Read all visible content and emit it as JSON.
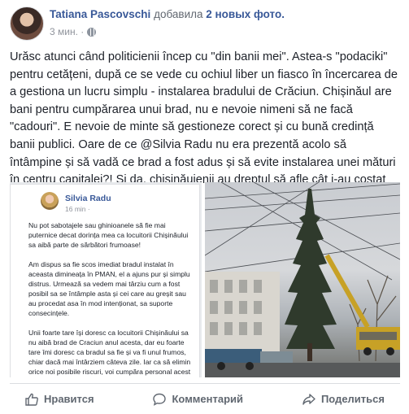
{
  "header": {
    "author": "Tatiana Pascovschi",
    "action": "добавила",
    "action_count": "2 новых фото.",
    "time": "3 мин. ·"
  },
  "post": {
    "text": "Urăsc atunci când politicienii încep cu \"din banii mei\". Astea-s \"podaciki\" pentru cetățeni, după ce se vede cu ochiul liber un fiasco în încercarea de a gestiona un lucru simplu - instalarea bradului de Crăciun. Chișinăul are bani pentru cumpărarea unui brad, nu e nevoie nimeni să ne facă \"cadouri\". E nevoie de minte să gestioneze corect și cu bună credință banii publici. Oare de ce @Silvia Radu nu era prezentă acolo să întâmpine și să vadă ce brad a fost adus și să evite instalarea unei mături în centru capitalei?! Și da, chișinăuienii au dreptul să afle cât i-au costat experimentele noii conduceri."
  },
  "photo1": {
    "name": "Silvia Radu",
    "meta": "16 min ·",
    "paragraphs": [
      "Nu pot sabotajele sau ghinioanele să fie mai puternice decat dorința mea ca locuitorii Chișinăului sa aibă parte de sărbători frumoase!",
      "Am dispus sa fie scos imediat bradul instalat în aceasta dimineața în PMAN, el a ajuns pur și simplu distrus. Urmează sa vedem mai târziu cum a fost posibil sa se întâmple asta și cei care au greșit sau au procedat asa în mod intenționat, sa suporte consecințele.",
      "Unii foarte tare își doresc ca locuitorii Chișinăului sa nu aibă brad de Craciun anul acesta, dar eu foarte tare îmi doresc ca bradul sa fie și va fi unul frumos, chiar dacă mai întârziem câteva zile. Iar ca să elimin orice noi posibile riscuri, voi cumpăra personal acest brad, din bani proprii, îl voi dona municipalității ca un"
    ]
  },
  "actions": {
    "like": "Нравится",
    "comment": "Комментарий",
    "share": "Поделиться"
  },
  "icons": {
    "like": "thumbs-up-icon",
    "comment": "speech-bubble-icon",
    "share": "share-arrow-icon",
    "privacy": "globe-icon"
  }
}
